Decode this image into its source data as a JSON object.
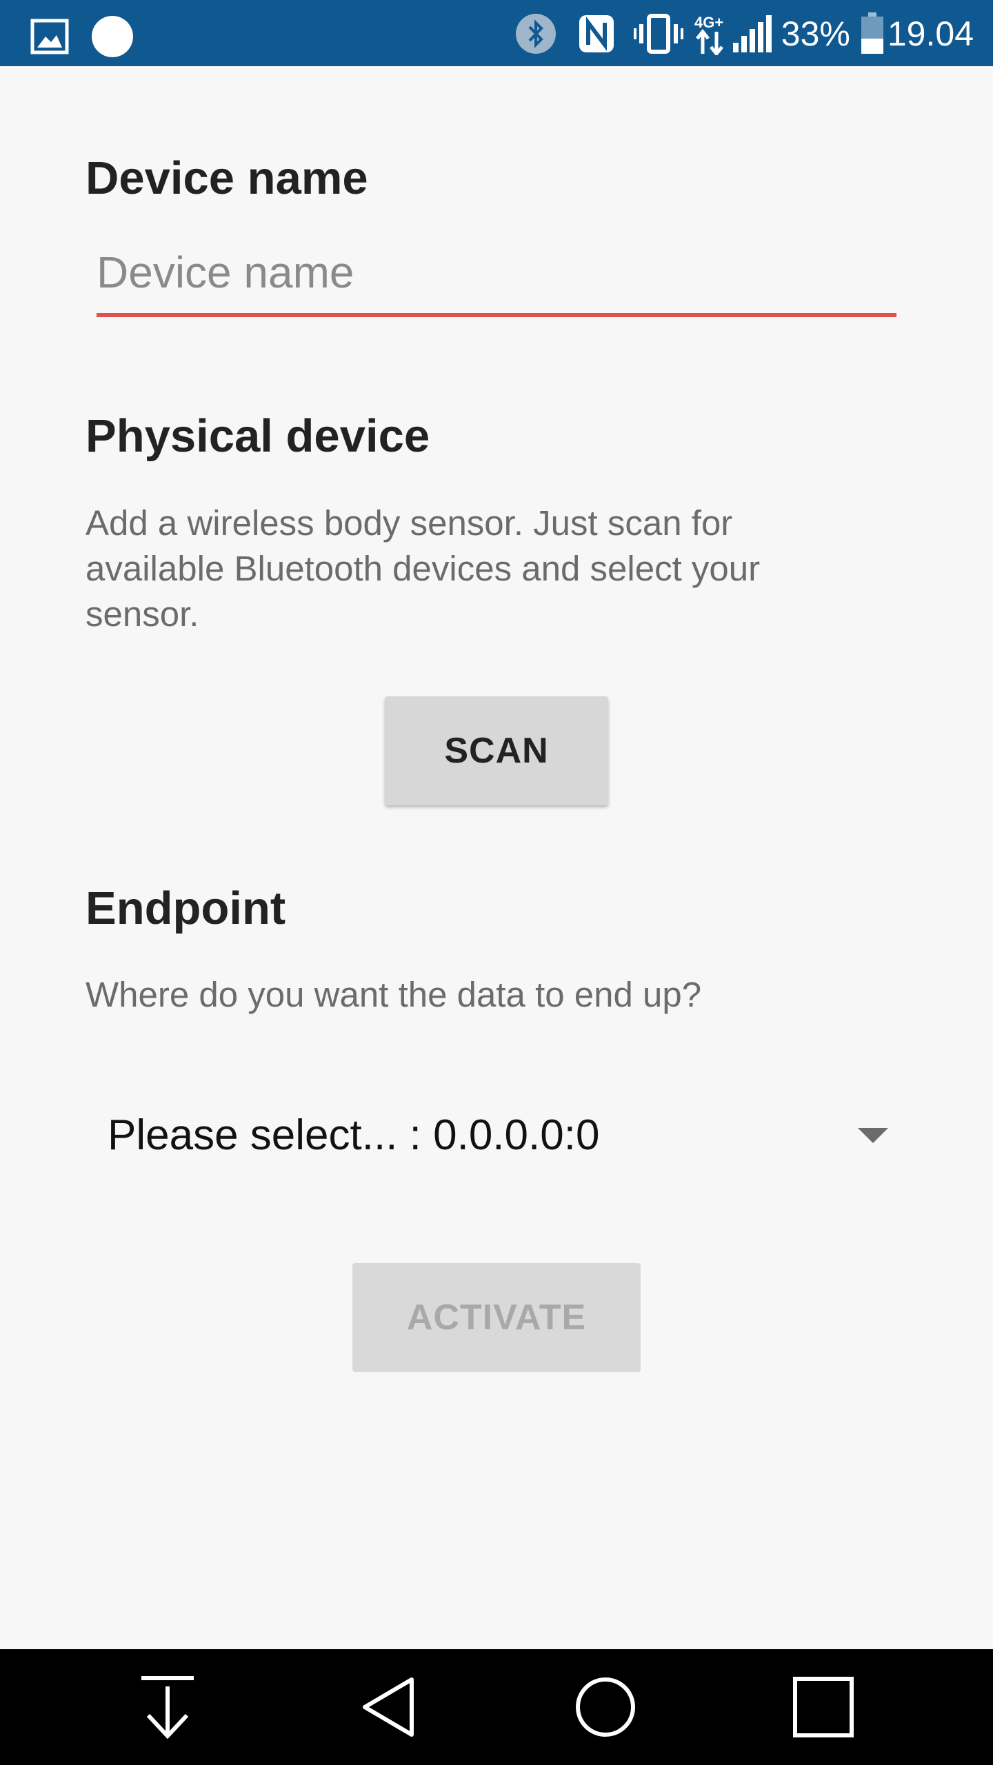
{
  "status_bar": {
    "icons_left": [
      "gallery-icon",
      "circle-notification-icon"
    ],
    "icons_right": [
      "bluetooth-icon",
      "nfc-icon",
      "vibrate-icon",
      "4g-data-icon",
      "signal-icon",
      "battery-icon"
    ],
    "battery": "33%",
    "time": "19.04",
    "color": "#105890"
  },
  "form": {
    "device_name": {
      "title": "Device name",
      "placeholder": "Device name",
      "underline_color": "#e0524f"
    },
    "physical_device": {
      "title": "Physical device",
      "description": "Add a wireless body sensor. Just scan for available Bluetooth devices and select your sensor.",
      "scan_label": "SCAN"
    },
    "endpoint": {
      "title": "Endpoint",
      "description": "Where do you want the data to end up?",
      "selected": "Please select... : 0.0.0.0:0"
    },
    "activate_label": "ACTIVATE"
  },
  "nav_bar": {
    "buttons": [
      "pull-down-icon",
      "back-icon",
      "home-icon",
      "recents-icon"
    ]
  }
}
